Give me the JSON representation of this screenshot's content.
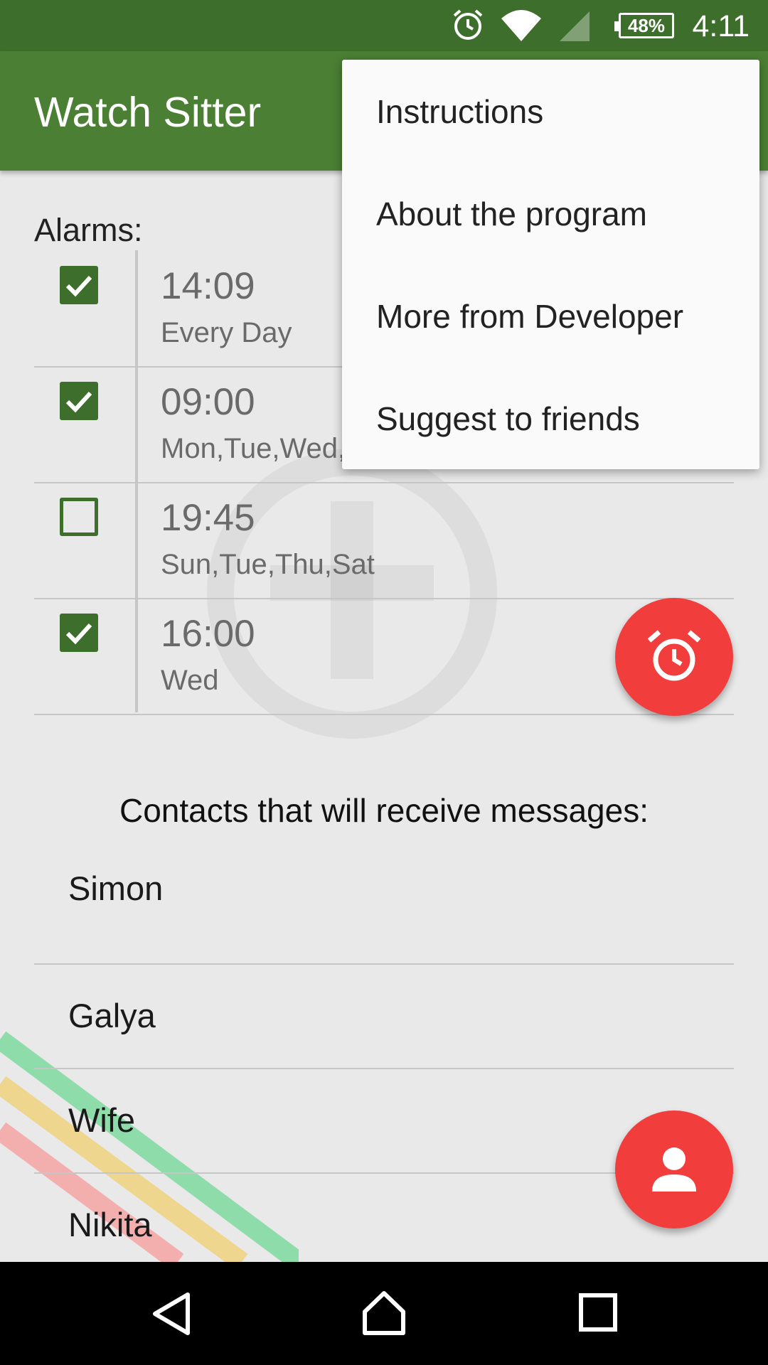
{
  "status_bar": {
    "time": "4:11",
    "battery": "48%",
    "icons": [
      "alarm-icon",
      "wifi-icon",
      "signal-icon",
      "battery-icon"
    ]
  },
  "app_bar": {
    "title": "Watch Sitter"
  },
  "alarms": {
    "label": "Alarms:",
    "items": [
      {
        "time": "14:09",
        "days": "Every Day",
        "enabled": true
      },
      {
        "time": "09:00",
        "days": "Mon,Tue,Wed,",
        "enabled": true
      },
      {
        "time": "19:45",
        "days": "Sun,Tue,Thu,Sat",
        "enabled": false
      },
      {
        "time": "16:00",
        "days": "Wed",
        "enabled": true
      }
    ]
  },
  "contacts": {
    "label": "Contacts that will receive messages:",
    "items": [
      "Simon",
      "Galya",
      "Wife",
      "Nikita"
    ]
  },
  "fabs": {
    "add_alarm_icon": "alarm-clock-icon",
    "add_contact_icon": "person-icon"
  },
  "overflow_menu": {
    "items": [
      "Instructions",
      "About the program",
      "More from Developer",
      "Suggest to friends"
    ]
  },
  "nav_bar": {
    "icons": [
      "back-icon",
      "home-icon",
      "recents-icon"
    ]
  },
  "colors": {
    "primary": "#4a7f34",
    "primary_dark": "#3e6e2c",
    "accent": "#f23d3d"
  }
}
